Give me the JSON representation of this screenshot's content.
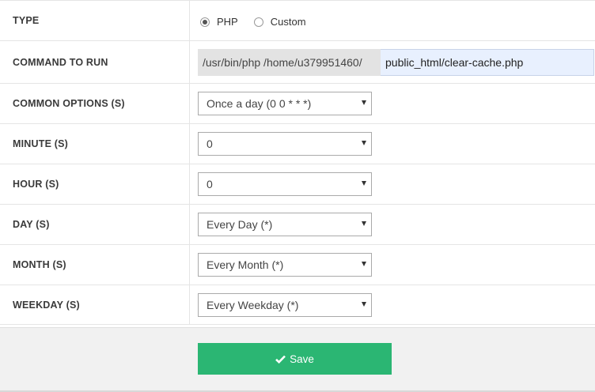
{
  "rows": {
    "type": {
      "label": "TYPE",
      "options": [
        {
          "label": "PHP",
          "checked": true
        },
        {
          "label": "Custom",
          "checked": false
        }
      ]
    },
    "command": {
      "label": "COMMAND TO RUN",
      "prefix": "/usr/bin/php /home/u379951460/",
      "value": "public_html/clear-cache.php"
    },
    "common_options": {
      "label": "COMMON OPTIONS (S)",
      "value": "Once a day (0 0 * * *)"
    },
    "minute": {
      "label": "MINUTE (S)",
      "value": "0"
    },
    "hour": {
      "label": "HOUR (S)",
      "value": "0"
    },
    "day": {
      "label": "DAY (S)",
      "value": "Every Day (*)"
    },
    "month": {
      "label": "MONTH (S)",
      "value": "Every Month (*)"
    },
    "weekday": {
      "label": "WEEKDAY (S)",
      "value": "Every Weekday (*)"
    }
  },
  "footer": {
    "save_label": "Save"
  },
  "colors": {
    "accent": "#2bb673",
    "input_highlight": "#e8f0fe",
    "prefix_bg": "#e3e3e3"
  },
  "icons": {
    "save": "check-icon",
    "select": "caret-down-icon"
  }
}
